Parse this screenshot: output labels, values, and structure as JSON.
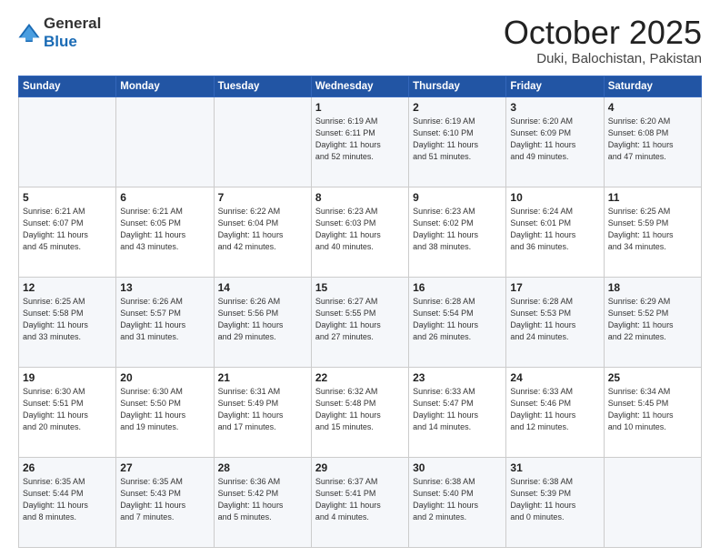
{
  "header": {
    "logo_general": "General",
    "logo_blue": "Blue",
    "month": "October 2025",
    "location": "Duki, Balochistan, Pakistan"
  },
  "weekdays": [
    "Sunday",
    "Monday",
    "Tuesday",
    "Wednesday",
    "Thursday",
    "Friday",
    "Saturday"
  ],
  "weeks": [
    [
      {
        "day": "",
        "info": ""
      },
      {
        "day": "",
        "info": ""
      },
      {
        "day": "",
        "info": ""
      },
      {
        "day": "1",
        "info": "Sunrise: 6:19 AM\nSunset: 6:11 PM\nDaylight: 11 hours\nand 52 minutes."
      },
      {
        "day": "2",
        "info": "Sunrise: 6:19 AM\nSunset: 6:10 PM\nDaylight: 11 hours\nand 51 minutes."
      },
      {
        "day": "3",
        "info": "Sunrise: 6:20 AM\nSunset: 6:09 PM\nDaylight: 11 hours\nand 49 minutes."
      },
      {
        "day": "4",
        "info": "Sunrise: 6:20 AM\nSunset: 6:08 PM\nDaylight: 11 hours\nand 47 minutes."
      }
    ],
    [
      {
        "day": "5",
        "info": "Sunrise: 6:21 AM\nSunset: 6:07 PM\nDaylight: 11 hours\nand 45 minutes."
      },
      {
        "day": "6",
        "info": "Sunrise: 6:21 AM\nSunset: 6:05 PM\nDaylight: 11 hours\nand 43 minutes."
      },
      {
        "day": "7",
        "info": "Sunrise: 6:22 AM\nSunset: 6:04 PM\nDaylight: 11 hours\nand 42 minutes."
      },
      {
        "day": "8",
        "info": "Sunrise: 6:23 AM\nSunset: 6:03 PM\nDaylight: 11 hours\nand 40 minutes."
      },
      {
        "day": "9",
        "info": "Sunrise: 6:23 AM\nSunset: 6:02 PM\nDaylight: 11 hours\nand 38 minutes."
      },
      {
        "day": "10",
        "info": "Sunrise: 6:24 AM\nSunset: 6:01 PM\nDaylight: 11 hours\nand 36 minutes."
      },
      {
        "day": "11",
        "info": "Sunrise: 6:25 AM\nSunset: 5:59 PM\nDaylight: 11 hours\nand 34 minutes."
      }
    ],
    [
      {
        "day": "12",
        "info": "Sunrise: 6:25 AM\nSunset: 5:58 PM\nDaylight: 11 hours\nand 33 minutes."
      },
      {
        "day": "13",
        "info": "Sunrise: 6:26 AM\nSunset: 5:57 PM\nDaylight: 11 hours\nand 31 minutes."
      },
      {
        "day": "14",
        "info": "Sunrise: 6:26 AM\nSunset: 5:56 PM\nDaylight: 11 hours\nand 29 minutes."
      },
      {
        "day": "15",
        "info": "Sunrise: 6:27 AM\nSunset: 5:55 PM\nDaylight: 11 hours\nand 27 minutes."
      },
      {
        "day": "16",
        "info": "Sunrise: 6:28 AM\nSunset: 5:54 PM\nDaylight: 11 hours\nand 26 minutes."
      },
      {
        "day": "17",
        "info": "Sunrise: 6:28 AM\nSunset: 5:53 PM\nDaylight: 11 hours\nand 24 minutes."
      },
      {
        "day": "18",
        "info": "Sunrise: 6:29 AM\nSunset: 5:52 PM\nDaylight: 11 hours\nand 22 minutes."
      }
    ],
    [
      {
        "day": "19",
        "info": "Sunrise: 6:30 AM\nSunset: 5:51 PM\nDaylight: 11 hours\nand 20 minutes."
      },
      {
        "day": "20",
        "info": "Sunrise: 6:30 AM\nSunset: 5:50 PM\nDaylight: 11 hours\nand 19 minutes."
      },
      {
        "day": "21",
        "info": "Sunrise: 6:31 AM\nSunset: 5:49 PM\nDaylight: 11 hours\nand 17 minutes."
      },
      {
        "day": "22",
        "info": "Sunrise: 6:32 AM\nSunset: 5:48 PM\nDaylight: 11 hours\nand 15 minutes."
      },
      {
        "day": "23",
        "info": "Sunrise: 6:33 AM\nSunset: 5:47 PM\nDaylight: 11 hours\nand 14 minutes."
      },
      {
        "day": "24",
        "info": "Sunrise: 6:33 AM\nSunset: 5:46 PM\nDaylight: 11 hours\nand 12 minutes."
      },
      {
        "day": "25",
        "info": "Sunrise: 6:34 AM\nSunset: 5:45 PM\nDaylight: 11 hours\nand 10 minutes."
      }
    ],
    [
      {
        "day": "26",
        "info": "Sunrise: 6:35 AM\nSunset: 5:44 PM\nDaylight: 11 hours\nand 8 minutes."
      },
      {
        "day": "27",
        "info": "Sunrise: 6:35 AM\nSunset: 5:43 PM\nDaylight: 11 hours\nand 7 minutes."
      },
      {
        "day": "28",
        "info": "Sunrise: 6:36 AM\nSunset: 5:42 PM\nDaylight: 11 hours\nand 5 minutes."
      },
      {
        "day": "29",
        "info": "Sunrise: 6:37 AM\nSunset: 5:41 PM\nDaylight: 11 hours\nand 4 minutes."
      },
      {
        "day": "30",
        "info": "Sunrise: 6:38 AM\nSunset: 5:40 PM\nDaylight: 11 hours\nand 2 minutes."
      },
      {
        "day": "31",
        "info": "Sunrise: 6:38 AM\nSunset: 5:39 PM\nDaylight: 11 hours\nand 0 minutes."
      },
      {
        "day": "",
        "info": ""
      }
    ]
  ]
}
